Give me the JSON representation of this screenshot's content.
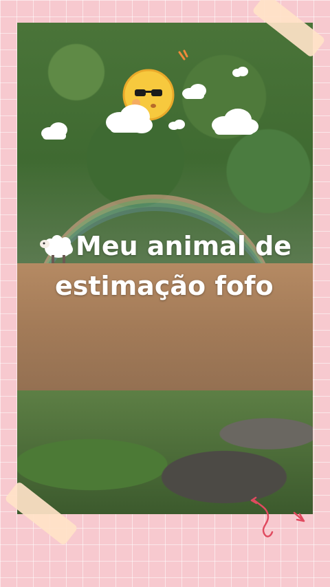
{
  "overlay": {
    "line1": "Meu animal de",
    "line2": "estimação fofo"
  },
  "stickers": {
    "sun": "sunglasses-sun-sticker",
    "clouds": "cloud-sticker",
    "sheep": "sheep-icon"
  },
  "colors": {
    "background": "#f7c9cf",
    "grid": "#ffffff",
    "tape": "#ffe3c8",
    "title_text": "#ffffff",
    "doodle": "#e04a5f"
  }
}
